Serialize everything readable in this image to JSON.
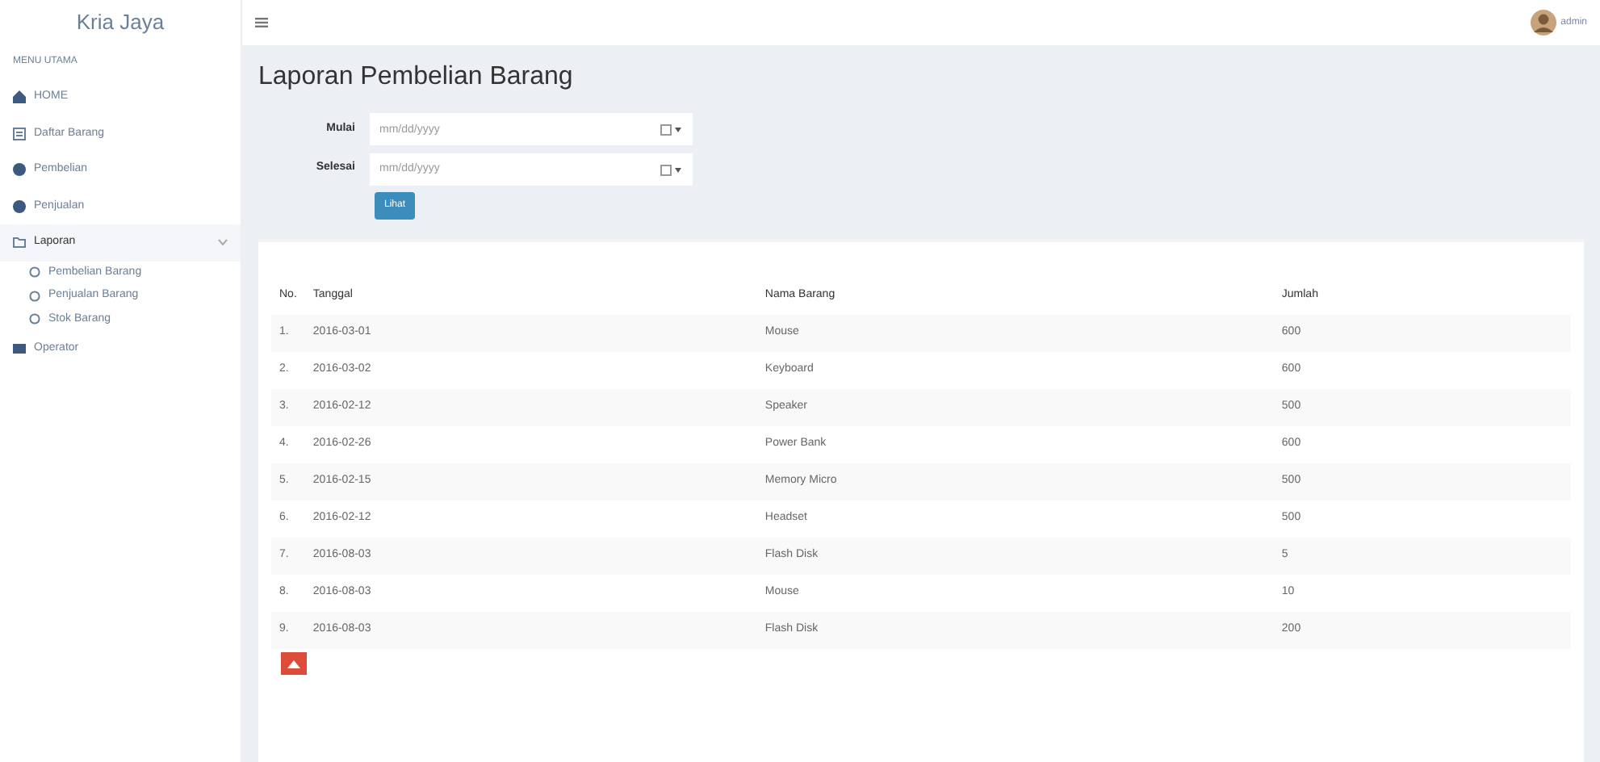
{
  "brand": "Kria Jaya",
  "user": {
    "name": "admin"
  },
  "sidebar": {
    "header": "MENU UTAMA",
    "items": [
      {
        "label": "HOME",
        "kind": "home",
        "selected": false
      },
      {
        "label": "Daftar Barang",
        "kind": "list",
        "selected": false
      },
      {
        "label": "Pembelian",
        "kind": "circle",
        "selected": false
      },
      {
        "label": "Penjualan",
        "kind": "circle",
        "selected": false
      },
      {
        "label": "Laporan",
        "kind": "folder",
        "selected": true,
        "expanded": true,
        "children": [
          {
            "label": "Pembelian Barang"
          },
          {
            "label": "Penjualan Barang"
          },
          {
            "label": "Stok Barang"
          }
        ]
      },
      {
        "label": "Operator",
        "kind": "users",
        "selected": false
      }
    ]
  },
  "page_title": "Laporan Pembelian Barang",
  "filter": {
    "fields": [
      {
        "label": "Mulai",
        "placeholder": "mm/dd/yyyy"
      },
      {
        "label": "Selesai",
        "placeholder": "mm/dd/yyyy"
      }
    ],
    "button": "Lihat"
  },
  "table": {
    "columns": [
      "No.",
      "Tanggal",
      "Nama Barang",
      "Jumlah"
    ],
    "rows": [
      [
        "1.",
        "2016-03-01",
        "Mouse",
        "600"
      ],
      [
        "2.",
        "2016-03-02",
        "Keyboard",
        "600"
      ],
      [
        "3.",
        "2016-02-12",
        "Speaker",
        "500"
      ],
      [
        "4.",
        "2016-02-26",
        "Power Bank",
        "600"
      ],
      [
        "5.",
        "2016-02-15",
        "Memory Micro",
        "500"
      ],
      [
        "6.",
        "2016-02-12",
        "Headset",
        "500"
      ],
      [
        "7.",
        "2016-08-03",
        "Flash Disk",
        "5"
      ],
      [
        "8.",
        "2016-08-03",
        "Mouse",
        "10"
      ],
      [
        "9.",
        "2016-08-03",
        "Flash Disk",
        "200"
      ]
    ]
  }
}
